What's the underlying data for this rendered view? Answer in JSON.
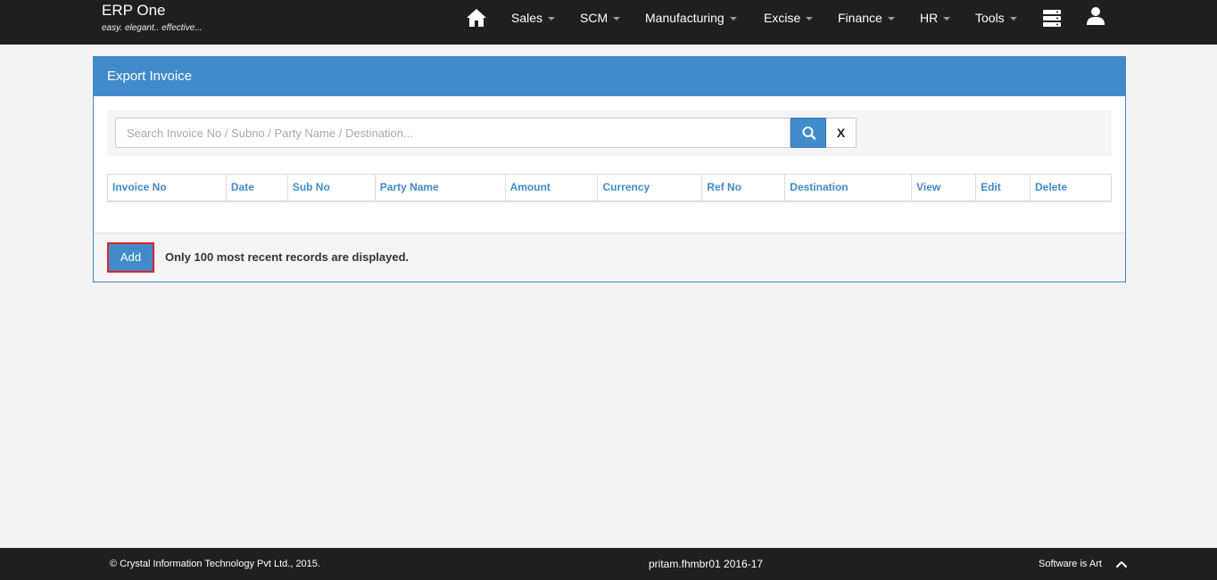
{
  "brand": {
    "name": "ERP One",
    "tagline": "easy. elegant.. effective..."
  },
  "nav": {
    "home_icon": "home-icon",
    "items": [
      {
        "label": "Sales"
      },
      {
        "label": "SCM"
      },
      {
        "label": "Manufacturing"
      },
      {
        "label": "Excise"
      },
      {
        "label": "Finance"
      },
      {
        "label": "HR"
      },
      {
        "label": "Tools"
      }
    ],
    "menu_icon": "server-stack-icon",
    "user_icon": "user-icon"
  },
  "panel": {
    "title": "Export Invoice",
    "search": {
      "placeholder": "Search Invoice No / Subno / Party Name / Destination...",
      "value": "",
      "clear_label": "X",
      "search_icon": "search-icon"
    },
    "table": {
      "columns": [
        "Invoice No",
        "Date",
        "Sub No",
        "Party Name",
        "Amount",
        "Currency",
        "Ref No",
        "Destination",
        "View",
        "Edit",
        "Delete"
      ],
      "rows": []
    },
    "footer": {
      "add_label": "Add",
      "note": "Only 100 most recent records are displayed."
    }
  },
  "bottom_bar": {
    "copyright": "© Crystal Information Technology Pvt Ltd., 2015.",
    "session": "pritam.fhmbr01 2016-17",
    "motto": "Software is Art",
    "scroll_top_icon": "chevron-up-icon"
  },
  "colors": {
    "navbar": "#1f1f1f",
    "accent": "#428bca",
    "highlight_border": "#d9262c"
  }
}
